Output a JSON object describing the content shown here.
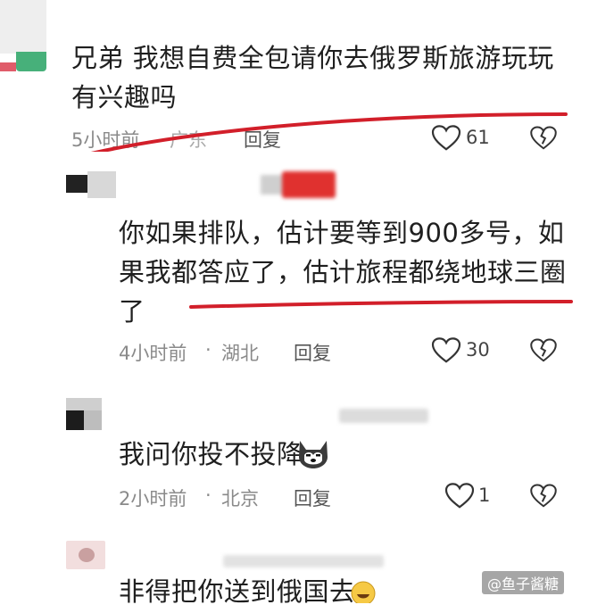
{
  "comments": [
    {
      "lines": [
        "兄弟 我想自费全包请你去俄罗斯旅游玩玩",
        "有兴趣吗"
      ],
      "time": "5小时前",
      "location": "广东",
      "reply_label": "回复",
      "likes": "61"
    },
    {
      "lines": [
        "你如果排队，估计要等到900多号，如",
        "果我都答应了，估计旅程都绕地球三圈",
        "了"
      ],
      "time": "4小时前",
      "sep": "·",
      "location": "湖北",
      "reply_label": "回复",
      "likes": "30"
    },
    {
      "lines": [
        "我问你投不投降"
      ],
      "time": "2小时前",
      "sep": "·",
      "location": "北京",
      "reply_label": "回复",
      "likes": "1"
    },
    {
      "lines": [
        "非得把你送到俄国去"
      ]
    }
  ],
  "watermark": "@鱼子酱糖",
  "colors": {
    "underline": "#d21f2a",
    "meta": "#8a8a8a"
  }
}
